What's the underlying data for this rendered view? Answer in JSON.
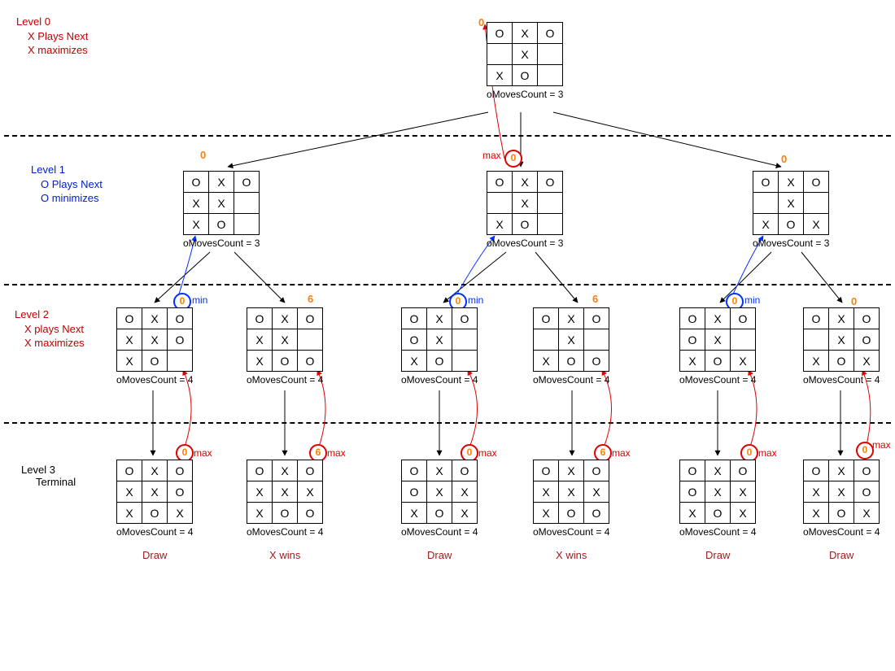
{
  "levels": {
    "l0": {
      "line1": "Level 0",
      "line2": "X Plays Next",
      "line3": "X maximizes"
    },
    "l1": {
      "line1": "Level 1",
      "line2": "O Plays Next",
      "line3": "O minimizes"
    },
    "l2": {
      "line1": "Level 2",
      "line2": "X plays Next",
      "line3": "X maximizes"
    },
    "l3": {
      "line1": "Level 3",
      "line2": "Terminal"
    }
  },
  "moves_label_3": "oMovesCount = 3",
  "moves_label_4": "oMovesCount = 4",
  "results": {
    "draw": "Draw",
    "xwins": "X wins"
  },
  "minmax": {
    "min": "min",
    "max": "max"
  },
  "score0": "0",
  "score6": "6",
  "boards": {
    "root": [
      [
        "O",
        "X",
        "O"
      ],
      [
        "",
        "X",
        ""
      ],
      [
        "X",
        "O",
        ""
      ]
    ],
    "L1a": [
      [
        "O",
        "X",
        "O"
      ],
      [
        "X",
        "X",
        ""
      ],
      [
        "X",
        "O",
        ""
      ]
    ],
    "L1b": [
      [
        "O",
        "X",
        "O"
      ],
      [
        "",
        "X",
        ""
      ],
      [
        "X",
        "O",
        ""
      ]
    ],
    "L1c": [
      [
        "O",
        "X",
        "O"
      ],
      [
        "",
        "X",
        ""
      ],
      [
        "X",
        "O",
        "X"
      ]
    ],
    "L2a1": [
      [
        "O",
        "X",
        "O"
      ],
      [
        "X",
        "X",
        "O"
      ],
      [
        "X",
        "O",
        ""
      ]
    ],
    "L2a2": [
      [
        "O",
        "X",
        "O"
      ],
      [
        "X",
        "X",
        ""
      ],
      [
        "X",
        "O",
        "O"
      ]
    ],
    "L2b1": [
      [
        "O",
        "X",
        "O"
      ],
      [
        "O",
        "X",
        ""
      ],
      [
        "X",
        "O",
        ""
      ]
    ],
    "L2b2": [
      [
        "O",
        "X",
        "O"
      ],
      [
        "",
        "X",
        ""
      ],
      [
        "X",
        "O",
        "O"
      ]
    ],
    "L2c1": [
      [
        "O",
        "X",
        "O"
      ],
      [
        "O",
        "X",
        ""
      ],
      [
        "X",
        "O",
        "X"
      ]
    ],
    "L2c2": [
      [
        "O",
        "X",
        "O"
      ],
      [
        "",
        "X",
        "O"
      ],
      [
        "X",
        "O",
        "X"
      ]
    ],
    "L3a1": [
      [
        "O",
        "X",
        "O"
      ],
      [
        "X",
        "X",
        "O"
      ],
      [
        "X",
        "O",
        "X"
      ]
    ],
    "L3a2": [
      [
        "O",
        "X",
        "O"
      ],
      [
        "X",
        "X",
        "X"
      ],
      [
        "X",
        "O",
        "O"
      ]
    ],
    "L3b1": [
      [
        "O",
        "X",
        "O"
      ],
      [
        "O",
        "X",
        "X"
      ],
      [
        "X",
        "O",
        "X"
      ]
    ],
    "L3b2": [
      [
        "O",
        "X",
        "O"
      ],
      [
        "X",
        "X",
        "X"
      ],
      [
        "X",
        "O",
        "O"
      ]
    ],
    "L3c1": [
      [
        "O",
        "X",
        "O"
      ],
      [
        "O",
        "X",
        "X"
      ],
      [
        "X",
        "O",
        "X"
      ]
    ],
    "L3c2": [
      [
        "O",
        "X",
        "O"
      ],
      [
        "X",
        "X",
        "O"
      ],
      [
        "X",
        "O",
        "X"
      ]
    ]
  }
}
